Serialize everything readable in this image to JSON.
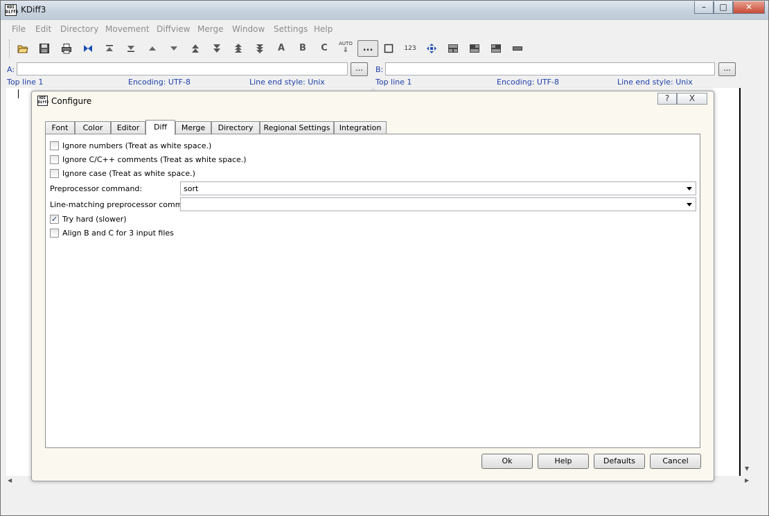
{
  "window": {
    "title": "KDiff3",
    "icon": "kdiff3-app-icon",
    "icon_text": "KDI Diff3"
  },
  "menu": [
    "File",
    "Edit",
    "Directory",
    "Movement",
    "Diffview",
    "Merge",
    "Window",
    "Settings",
    "Help"
  ],
  "toolbar": {
    "auto_label": "AUTO",
    "text_buttons": {
      "a": "A",
      "b": "B",
      "c": "C",
      "num": "123",
      "wspace": "..."
    }
  },
  "inputs": {
    "a_label": "A:",
    "a_value": "",
    "b_label": "B:",
    "b_value": "",
    "browse_label": "..."
  },
  "info": {
    "a": {
      "top_line": "Top line 1",
      "encoding": "Encoding: UTF-8",
      "line_end": "Line end style: Unix"
    },
    "b": {
      "top_line": "Top line 1",
      "encoding": "Encoding: UTF-8",
      "line_end": "Line end style: Unix"
    }
  },
  "dialog": {
    "title": "Configure",
    "help_label": "?",
    "close_label": "X",
    "tabs": [
      "Font",
      "Color",
      "Editor",
      "Diff",
      "Merge",
      "Directory",
      "Regional Settings",
      "Integration"
    ],
    "selected_tab": "Diff",
    "options": [
      {
        "label": "Ignore numbers (Treat as white space.)",
        "checked": false
      },
      {
        "label": "Ignore C/C++ comments (Treat as white space.)",
        "checked": false
      },
      {
        "label": "Ignore case (Treat as white space.)",
        "checked": false
      }
    ],
    "preprocessor": {
      "label": "Preprocessor command:",
      "value": "sort"
    },
    "line_matching": {
      "label": "Line-matching preprocessor command:",
      "value": ""
    },
    "options2": [
      {
        "label": "Try hard (slower)",
        "checked": true
      },
      {
        "label": "Align B and C for 3 input files",
        "checked": false
      }
    ],
    "buttons": {
      "ok": "Ok",
      "help": "Help",
      "defaults": "Defaults",
      "cancel": "Cancel"
    }
  }
}
